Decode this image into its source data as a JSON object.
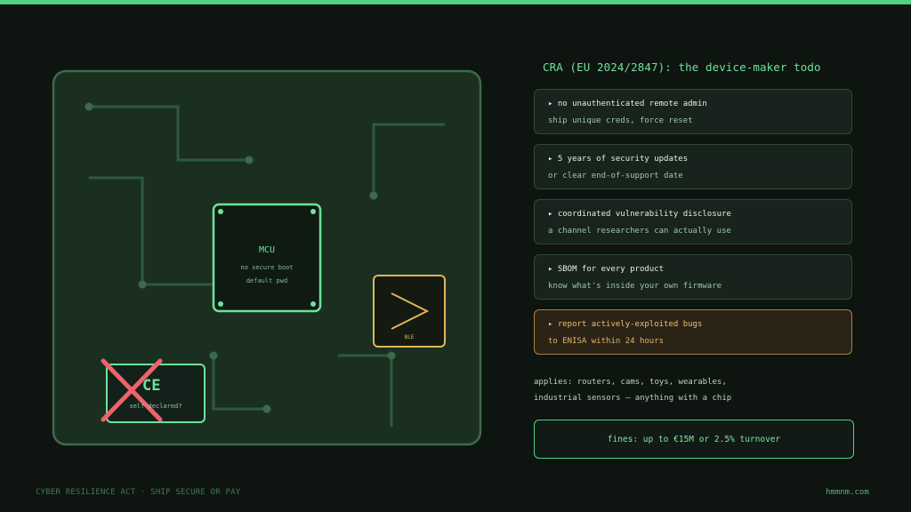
{
  "board": {
    "mcu": {
      "title": "MCU",
      "line1": "no secure boot",
      "line2": "default pwd"
    },
    "ble": {
      "label": "BLE"
    },
    "ce": {
      "label": "CE",
      "sub": "self-declared?"
    }
  },
  "title": "CRA (EU 2024/2847): the device-maker todo",
  "cards": [
    {
      "head": "▸ no unauthenticated remote admin",
      "sub": "ship unique creds, force reset"
    },
    {
      "head": "▸ 5 years of security updates",
      "sub": "or clear end-of-support date"
    },
    {
      "head": "▸ coordinated vulnerability disclosure",
      "sub": "a channel researchers can actually use"
    },
    {
      "head": "▸ SBOM for every product",
      "sub": "know what's inside your own firmware"
    },
    {
      "head": "▸ report actively-exploited bugs",
      "sub": "to ENISA within 24 hours"
    }
  ],
  "applies": {
    "line1": "applies: routers, cams, toys, wearables,",
    "line2": "industrial sensors — anything with a chip"
  },
  "fines": "fines: up to €15M or 2.5% turnover",
  "footer": {
    "left": "CYBER RESILIENCE ACT · SHIP SECURE OR PAY",
    "right": "hmmnm.com"
  },
  "colors": {
    "accent": "#4fd47b",
    "warning": "#e2b45a",
    "danger": "#f0626b"
  }
}
